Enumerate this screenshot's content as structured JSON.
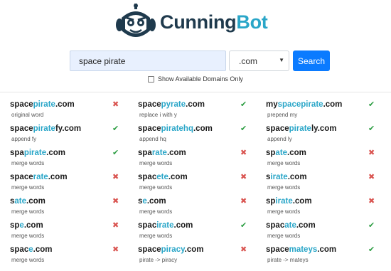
{
  "brand": {
    "name_part1": "Cunning",
    "name_part2": "Bot",
    "logo_icon": "robot-head-icon"
  },
  "search": {
    "query": "space pirate",
    "tld": ".com",
    "button_label": "Search"
  },
  "filter": {
    "available_only_label": "Show Available Domains Only",
    "checked": false
  },
  "colors": {
    "accent": "#2aa6c8",
    "brand_dark": "#1f3a4d",
    "button": "#0b7bff",
    "available": "#2e9e44",
    "taken": "#d9534f"
  },
  "results": [
    [
      {
        "parts": [
          [
            "space",
            "n"
          ],
          [
            "pirate",
            "h"
          ],
          [
            ".com",
            "n"
          ]
        ],
        "note": "original word",
        "available": false
      },
      {
        "parts": [
          [
            "space",
            "n"
          ],
          [
            "pirate",
            "h"
          ],
          [
            "fy",
            "n"
          ],
          [
            ".com",
            "n"
          ]
        ],
        "note": "append fy",
        "available": true
      },
      {
        "parts": [
          [
            "spa",
            "n"
          ],
          [
            "pirate",
            "h"
          ],
          [
            ".com",
            "n"
          ]
        ],
        "note": "merge words",
        "available": true
      },
      {
        "parts": [
          [
            "space",
            "n"
          ],
          [
            "rate",
            "h"
          ],
          [
            ".com",
            "n"
          ]
        ],
        "note": "merge words",
        "available": false
      },
      {
        "parts": [
          [
            "s",
            "n"
          ],
          [
            "ate",
            "h"
          ],
          [
            ".com",
            "n"
          ]
        ],
        "note": "merge words",
        "available": false
      },
      {
        "parts": [
          [
            "sp",
            "n"
          ],
          [
            "e",
            "h"
          ],
          [
            ".com",
            "n"
          ]
        ],
        "note": "merge words",
        "available": false
      },
      {
        "parts": [
          [
            "spac",
            "n"
          ],
          [
            "e",
            "h"
          ],
          [
            ".com",
            "n"
          ]
        ],
        "note": "merge words",
        "available": false
      }
    ],
    [
      {
        "parts": [
          [
            "space",
            "n"
          ],
          [
            "pyrate",
            "h"
          ],
          [
            ".com",
            "n"
          ]
        ],
        "note": "replace i with y",
        "available": true
      },
      {
        "parts": [
          [
            "space",
            "n"
          ],
          [
            "piratehq",
            "h"
          ],
          [
            ".com",
            "n"
          ]
        ],
        "note": "append hq",
        "available": true
      },
      {
        "parts": [
          [
            "spa",
            "n"
          ],
          [
            "rate",
            "h"
          ],
          [
            ".com",
            "n"
          ]
        ],
        "note": "merge words",
        "available": false
      },
      {
        "parts": [
          [
            "spac",
            "n"
          ],
          [
            "ete",
            "h"
          ],
          [
            ".com",
            "n"
          ]
        ],
        "note": "merge words",
        "available": false
      },
      {
        "parts": [
          [
            "s",
            "n"
          ],
          [
            "e",
            "h"
          ],
          [
            ".com",
            "n"
          ]
        ],
        "note": "merge words",
        "available": false
      },
      {
        "parts": [
          [
            "spac",
            "n"
          ],
          [
            "irate",
            "h"
          ],
          [
            ".com",
            "n"
          ]
        ],
        "note": "merge words",
        "available": true
      },
      {
        "parts": [
          [
            "space",
            "n"
          ],
          [
            "piracy",
            "h"
          ],
          [
            ".com",
            "n"
          ]
        ],
        "note": "pirate -> piracy",
        "available": false
      }
    ],
    [
      {
        "parts": [
          [
            "my",
            "n"
          ],
          [
            "spacepirate",
            "h"
          ],
          [
            ".com",
            "n"
          ]
        ],
        "note": "prepend my",
        "available": true
      },
      {
        "parts": [
          [
            "space",
            "n"
          ],
          [
            "pirate",
            "h"
          ],
          [
            "ly",
            "n"
          ],
          [
            ".com",
            "n"
          ]
        ],
        "note": "append ly",
        "available": true
      },
      {
        "parts": [
          [
            "sp",
            "n"
          ],
          [
            "ate",
            "h"
          ],
          [
            ".com",
            "n"
          ]
        ],
        "note": "merge words",
        "available": false
      },
      {
        "parts": [
          [
            "s",
            "n"
          ],
          [
            "irate",
            "h"
          ],
          [
            ".com",
            "n"
          ]
        ],
        "note": "merge words",
        "available": false
      },
      {
        "parts": [
          [
            "sp",
            "n"
          ],
          [
            "irate",
            "h"
          ],
          [
            ".com",
            "n"
          ]
        ],
        "note": "merge words",
        "available": false
      },
      {
        "parts": [
          [
            "spac",
            "n"
          ],
          [
            "ate",
            "h"
          ],
          [
            ".com",
            "n"
          ]
        ],
        "note": "merge words",
        "available": true
      },
      {
        "parts": [
          [
            "space",
            "n"
          ],
          [
            "mateys",
            "h"
          ],
          [
            ".com",
            "n"
          ]
        ],
        "note": "pirate -> mateys",
        "available": true
      }
    ]
  ]
}
